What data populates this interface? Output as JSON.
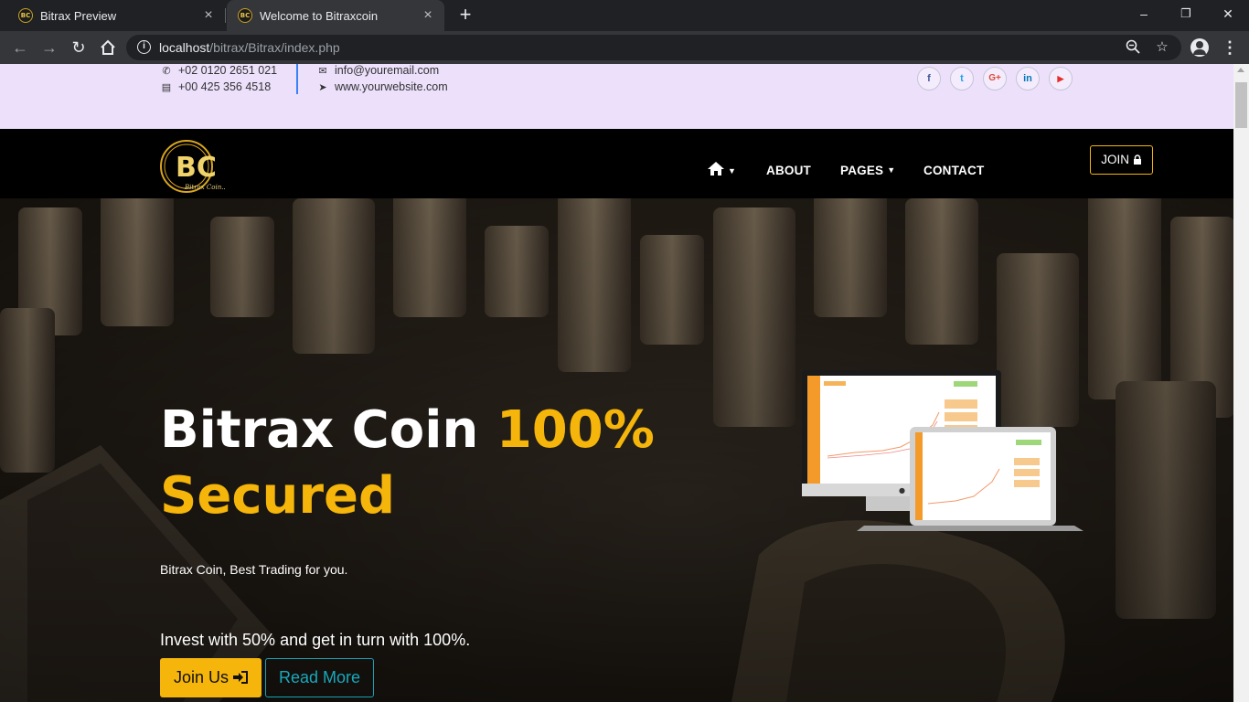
{
  "browser": {
    "tabs": [
      {
        "title": "Bitrax Preview",
        "favicon": "BC"
      },
      {
        "title": "Welcome to Bitraxcoin",
        "favicon": "BC"
      }
    ],
    "url_host": "localhost",
    "url_path": "/bitrax/Bitrax/index.php",
    "new_tab_label": "+",
    "window_controls": {
      "minimize": "–",
      "restore": "❐",
      "close": "✕"
    }
  },
  "topbar": {
    "phone1": "+02 0120 2651 021",
    "phone2": "+00 425 356 4518",
    "email": "info@youremail.com",
    "website": "www.yourwebsite.com",
    "icons": {
      "phone": "phone-icon",
      "fax": "fax-icon",
      "email": "envelope-icon",
      "web": "paper-plane-icon"
    },
    "social": [
      {
        "name": "facebook-icon",
        "glyph": "f",
        "color": "#3b5998"
      },
      {
        "name": "twitter-icon",
        "glyph": "t",
        "color": "#1da1f2"
      },
      {
        "name": "google-plus-icon",
        "glyph": "G+",
        "color": "#dd4b39"
      },
      {
        "name": "linkedin-icon",
        "glyph": "in",
        "color": "#0077b5"
      },
      {
        "name": "youtube-icon",
        "glyph": "▶",
        "color": "#e52d27"
      }
    ]
  },
  "nav": {
    "logo_text": "BC",
    "logo_tagline": "Bitrax Coin...",
    "items": [
      "ABOUT",
      "PAGES",
      "CONTACT"
    ],
    "join_label": "JOIN"
  },
  "hero": {
    "title_white": "Bitrax Coin ",
    "title_accent_1": "100%",
    "title_accent_2": "Secured",
    "subtitle": "Bitrax Coin, Best Trading for you.",
    "invest": "Invest with 50% and get in turn with 100%.",
    "join_button": "Join Us",
    "read_more_button": "Read More"
  },
  "colors": {
    "accent": "#f5b50a",
    "teal": "#18a8bc",
    "infobar": "#ece0fb",
    "nav": "#000000"
  }
}
